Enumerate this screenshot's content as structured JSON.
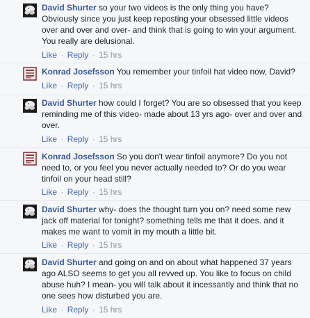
{
  "actions": {
    "like": "Like",
    "reply": "Reply",
    "separator": "·"
  },
  "comments": [
    {
      "author": "David Shurter",
      "avatar": "david-avatar",
      "text": "so your two videos is the only thing you have? Obviously since you just keep reposting your obsessed little videos over and over and over- and think that is going to win your argument. You really are delusional.",
      "time": "15 hrs"
    },
    {
      "author": "Konrad Josefsson",
      "avatar": "konrad-avatar",
      "text": "You remember your tinfoil hat video now, David?",
      "time": "15 hrs"
    },
    {
      "author": "David Shurter",
      "avatar": "david-avatar",
      "text": "how could I forget? You are so obsessed that you keep reminding me of this video- made about 13 yrs ago- over and over and over.",
      "time": "15 hrs"
    },
    {
      "author": "Konrad Josefsson",
      "avatar": "konrad-avatar",
      "text": "So you don't wear tinfoil anymore? Do you not need to, or you feel you never actually needed to? Or do you wear tinfoil on your head still?",
      "time": "15 hrs"
    },
    {
      "author": "David Shurter",
      "avatar": "david-avatar",
      "text": "why- does the thought turn you on? need some new jack off material for tonight? something tells me that it does. and it makes me want to vomit in my mouth a little bit.",
      "time": "15 hrs"
    },
    {
      "author": "David Shurter",
      "avatar": "david-avatar",
      "text": "and going on and on about what happened 37 years ago ALSO seems to get you all revved up. You like to focus on child abuse huh? I mean- you will talk about it incessantly and think that no one sees how disturbed you are.",
      "time": "15 hrs"
    }
  ]
}
